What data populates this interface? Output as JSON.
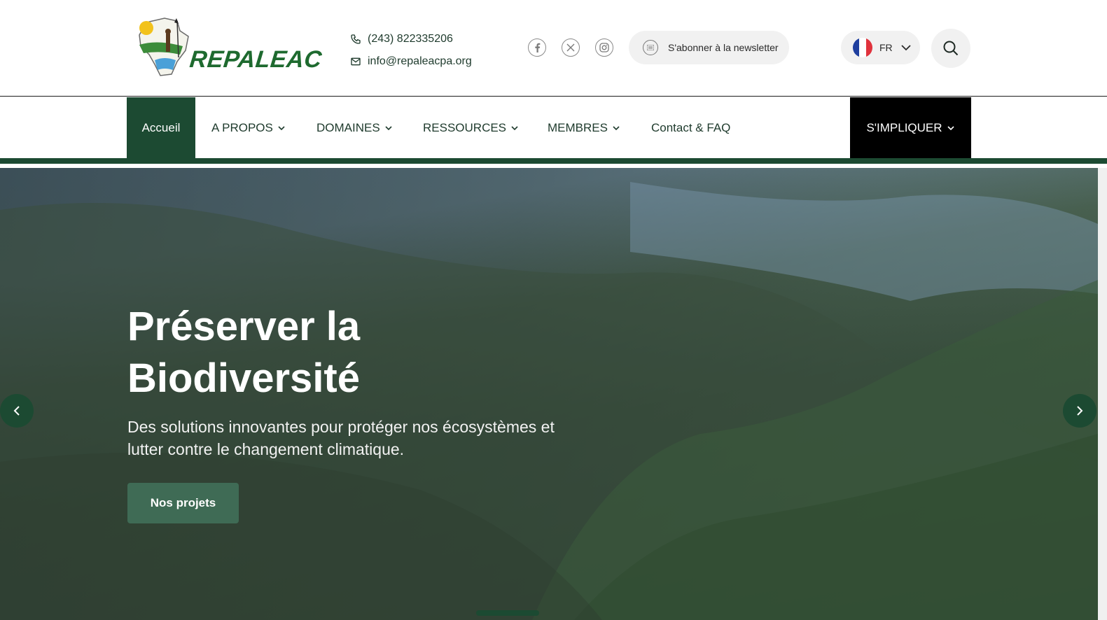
{
  "brand": {
    "name": "REPALEAC",
    "logo_icon": "africa-map-logo-icon"
  },
  "contact": {
    "phone": "(243) 822335206",
    "email": "info@repaleacpa.org"
  },
  "socials": [
    {
      "name": "facebook",
      "icon": "facebook-icon"
    },
    {
      "name": "x",
      "icon": "x-twitter-icon"
    },
    {
      "name": "instagram",
      "icon": "instagram-icon"
    }
  ],
  "newsletter": {
    "label": "S'abonner à la newsletter"
  },
  "language": {
    "code": "FR",
    "flag_colors": [
      "#1f3f9f",
      "#ffffff",
      "#e0323c"
    ]
  },
  "nav": {
    "home": "Accueil",
    "about": "A PROPOS",
    "domains": "DOMAINES",
    "resources": "RESSOURCES",
    "members": "MEMBRES",
    "contact": "Contact & FAQ",
    "involve": "S'IMPLIQUER"
  },
  "hero": {
    "title_line1": "Préserver la",
    "title_line2": "Biodiversité",
    "subtitle": "Des solutions innovantes pour protéger nos écosystèmes et lutter contre le changement climatique.",
    "cta": "Nos projets"
  },
  "colors": {
    "primary_green": "#1c4a32",
    "cta_green": "#3f6b55",
    "involve_bg": "#000000"
  }
}
